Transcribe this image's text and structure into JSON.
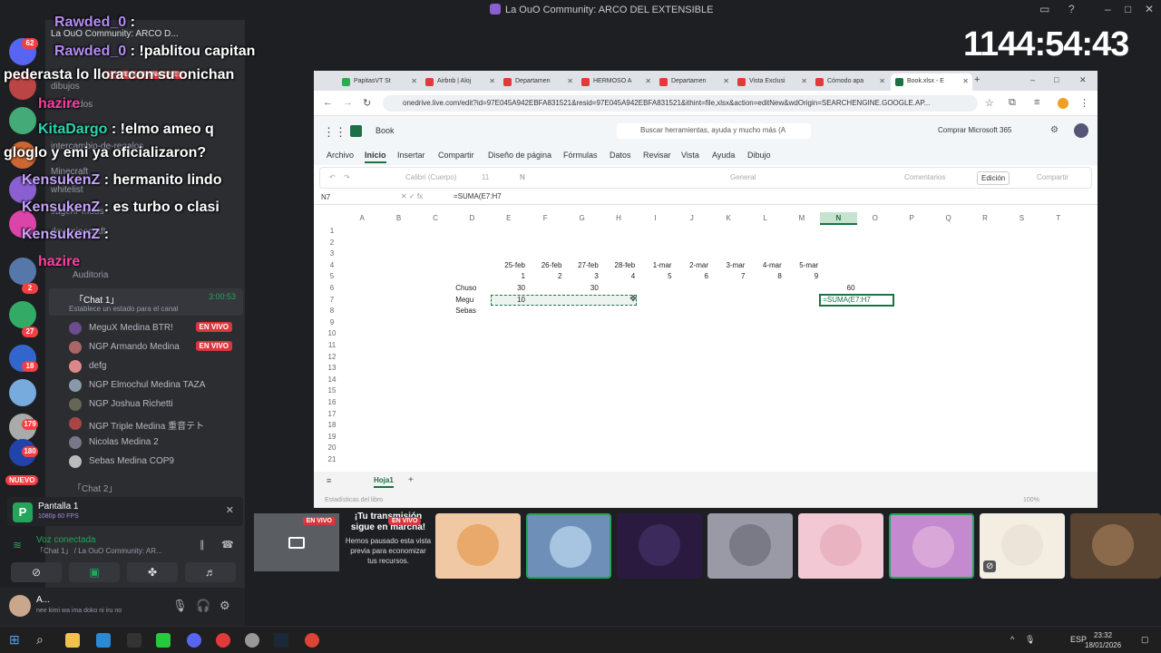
{
  "window": {
    "title": "La OuO Community: ARCO DEL EXTENSIBLE"
  },
  "rail": {
    "badges": [
      "62",
      "2",
      "27",
      "18",
      "179",
      "180"
    ],
    "new_label": "NUEVO"
  },
  "channels": {
    "items": [
      {
        "label": "La OuO Community: ARCO D..."
      },
      {
        "label": "dibujos"
      },
      {
        "label": "comandos"
      },
      {
        "label": "intercambio-de-regalos"
      },
      {
        "label": "Minecraft"
      },
      {
        "label": "whitelist"
      },
      {
        "label": "sugerir-mods"
      },
      {
        "label": "dev-minecraft"
      },
      {
        "label": "Auditoria"
      }
    ],
    "voice_channel": {
      "name": "「Chat 1」",
      "time": "3:00:53",
      "status": "Establece un estado para el canal"
    },
    "members": [
      {
        "name": "MeguX Medina",
        "tag": "BTR!",
        "live": "EN VIVO"
      },
      {
        "name": "NGP Armando Medina",
        "tag": "",
        "live": "EN VIVO"
      },
      {
        "name": "defg",
        "tag": "",
        "live": ""
      },
      {
        "name": "NGP Elmochul Medina",
        "tag": "TAZA",
        "live": ""
      },
      {
        "name": "NGP Joshua Richetti",
        "tag": "",
        "live": ""
      },
      {
        "name": "NGP Triple Medina",
        "tag": "重音テト",
        "live": ""
      },
      {
        "name": "Nicolas Medina 2",
        "tag": "",
        "live": ""
      },
      {
        "name": "Sebas Medina",
        "tag": "COP9",
        "live": ""
      }
    ],
    "chat2": "「Chat 2」"
  },
  "stream_box": {
    "title": "Pantalla 1",
    "sub": "1080p 60 FPS"
  },
  "voice": {
    "status": "Voz conectada",
    "detail": "「Chat 1」 / La OuO Community: AR..."
  },
  "user": {
    "name": "A...",
    "status": "nee kimi wa ima doko ni iru no"
  },
  "overlay": {
    "mentions": "3 NUEVAS MENCIONES",
    "lines": [
      {
        "user": "Rawded_0",
        "text": " :"
      },
      {
        "user": "Rawded_0",
        "text": " : !pablitou capitan"
      },
      {
        "user": "",
        "text": "pederasta lo llora con su onichan"
      },
      {
        "user": "hazire",
        "text": ""
      },
      {
        "user": "KitaDargo",
        "text": " : !elmo ameo         q"
      },
      {
        "user": "",
        "text": "gloglo y emi ya oficializaron?"
      },
      {
        "user": "KensukenZ",
        "text": " : hermanito lindo"
      },
      {
        "user": "KensukenZ",
        "text": " : es turbo o clasi"
      },
      {
        "user": "KensukenZ",
        "text": " :"
      },
      {
        "user": "hazire",
        "text": ""
      }
    ]
  },
  "timer": "1144:54:43",
  "browser": {
    "tabs": [
      {
        "label": "PapitasVT St",
        "color": "#2fa84f"
      },
      {
        "label": "Airbnb | Aloj",
        "color": "#e03a3a"
      },
      {
        "label": "Departamen",
        "color": "#e03a3a"
      },
      {
        "label": "HERMOSO A",
        "color": "#e03a3a"
      },
      {
        "label": "Departamen",
        "color": "#e03a3a"
      },
      {
        "label": "Vista Exclusi",
        "color": "#e03a3a"
      },
      {
        "label": "Cómodo apa",
        "color": "#e03a3a"
      },
      {
        "label": "Book.xlsx - E",
        "color": "#1e7145"
      }
    ],
    "url": "onedrive.live.com/edit?id=97E045A942EBFA831521&resid=97E045A942EBFA831521&ithint=file,xlsx&action=editNew&wdOrigin=SEARCHENGINE.GOOGLE.AP..."
  },
  "excel": {
    "book": "Book",
    "search_placeholder": "Buscar herramientas, ayuda y mucho más (A",
    "buy": "Comprar Microsoft 365",
    "ribbon_tabs": [
      "Archivo",
      "Inicio",
      "Insertar",
      "Compartir",
      "Diseño de página",
      "Fórmulas",
      "Datos",
      "Revisar",
      "Vista",
      "Ayuda",
      "Dibujo"
    ],
    "active_tab": "Inicio",
    "font": "Calibri (Cuerpo)",
    "font_size": "11",
    "number_format": "General",
    "comments": "Comentarios",
    "edit_mode": "Edición",
    "share": "Compartir",
    "name_box": "N7",
    "formula": "=SUMA(E7:H7",
    "columns": [
      "A",
      "B",
      "C",
      "D",
      "E",
      "F",
      "G",
      "H",
      "I",
      "J",
      "K",
      "L",
      "M",
      "N",
      "O",
      "P",
      "Q",
      "R",
      "S",
      "T"
    ],
    "rows": [
      "1",
      "2",
      "3",
      "4",
      "5",
      "6",
      "7",
      "8",
      "9",
      "10",
      "11",
      "12",
      "13",
      "14",
      "15",
      "16",
      "17",
      "18",
      "19",
      "20",
      "21"
    ],
    "dates": [
      "25-feb",
      "26-feb",
      "27-feb",
      "28-feb",
      "1-mar",
      "2-mar",
      "3-mar",
      "4-mar",
      "5-mar"
    ],
    "nums": [
      "1",
      "2",
      "3",
      "4",
      "5",
      "6",
      "7",
      "8",
      "9"
    ],
    "names": [
      "Chuso",
      "Megu",
      "Sebas"
    ],
    "chuso_e": "30",
    "chuso_g": "30",
    "megu_e": "10",
    "n6": "60",
    "n7": "=SUMA(E7:H7",
    "sheet": "Hoja1",
    "status": "Estadísticas del libro",
    "zoom": "100%"
  },
  "participants": {
    "screen_live": "EN VIVO",
    "paused_live": "EN VIVO",
    "paused_title": "¡Tu transmisión sigue en marcha!",
    "paused_text": "Hemos pausado esta vista previa para economizar tus recursos.",
    "tile_colors": [
      "#e8a96a",
      "#a7c4e0",
      "#3d2a5c",
      "#7a7a86",
      "#e9b3c2",
      "#d9a8d8",
      "#ece4d8",
      "#8a6a4a"
    ]
  },
  "taskbar": {
    "time": "23:32",
    "date": "18/01/2026",
    "lang": "ESP"
  }
}
